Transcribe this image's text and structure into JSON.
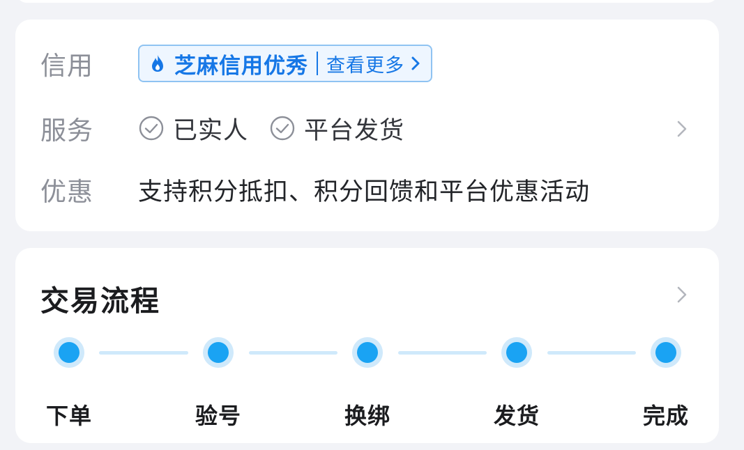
{
  "info": {
    "credit": {
      "label": "信用",
      "badge_text": "芝麻信用优秀",
      "more_text": "查看更多"
    },
    "service": {
      "label": "服务",
      "items": [
        "已实人",
        "平台发货"
      ]
    },
    "promo": {
      "label": "优惠",
      "text": "支持积分抵扣、积分回馈和平台优惠活动"
    }
  },
  "process": {
    "title": "交易流程",
    "steps": [
      "下单",
      "验号",
      "换绑",
      "发货",
      "完成"
    ]
  },
  "colors": {
    "accent": "#1677e6",
    "step_dot": "#1aa3f3",
    "step_line": "#cfe9fb",
    "label_gray": "#8c8f98",
    "page_bg": "#f2f3f7"
  },
  "icons": {
    "credit": "flame-drop-icon",
    "service_check": "check-circle-icon",
    "chevron": "chevron-right-icon"
  }
}
